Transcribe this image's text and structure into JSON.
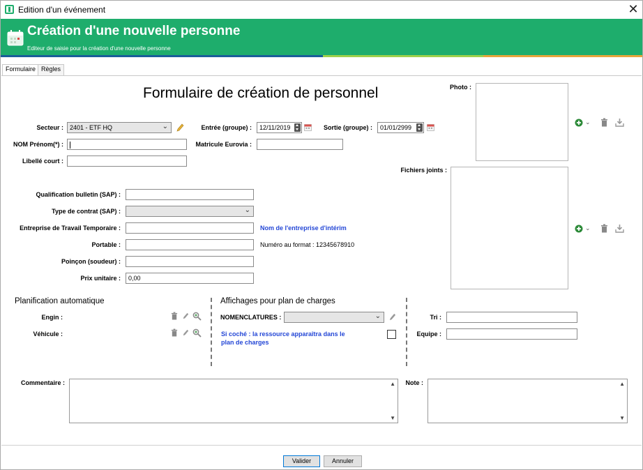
{
  "window": {
    "title": "Edition d'un événement"
  },
  "banner": {
    "title": "Création d'une nouvelle personne",
    "subtitle": "Editeur de saisie pour la création d'une nouvelle personne"
  },
  "tabs": [
    {
      "label": "Formulaire"
    },
    {
      "label": "Règles"
    }
  ],
  "form": {
    "title": "Formulaire de création de personnel",
    "secteur": {
      "label": "Secteur :",
      "value": "2401 - ETF HQ"
    },
    "entree": {
      "label": "Entrée (groupe) :",
      "value": "12/11/2019"
    },
    "sortie": {
      "label": "Sortie (groupe) :",
      "value": "01/01/2999"
    },
    "nom": {
      "label": "NOM Prénom(*) :",
      "value": ""
    },
    "matricule": {
      "label": "Matricule Eurovia :",
      "value": ""
    },
    "libelle": {
      "label": "Libellé court :",
      "value": ""
    },
    "qualification": {
      "label": "Qualification bulletin (SAP) :",
      "value": ""
    },
    "contrat": {
      "label": "Type de contrat (SAP) :",
      "value": ""
    },
    "ett": {
      "label": "Entreprise de Travail Temporaire :",
      "value": "",
      "hint": "Nom de l'entreprise d'intérim"
    },
    "portable": {
      "label": "Portable :",
      "value": "",
      "hint": "Numéro au format : 12345678910"
    },
    "poincon": {
      "label": "Poinçon (soudeur) :",
      "value": ""
    },
    "prix": {
      "label": "Prix unitaire :",
      "value": "0,00"
    }
  },
  "photo": {
    "label": "Photo :"
  },
  "fichiers": {
    "label": "Fichiers joints :"
  },
  "planification": {
    "title": "Planification automatique",
    "engin_label": "Engin :",
    "vehicule_label": "Véhicule :"
  },
  "affichages": {
    "title": "Affichages pour plan de charges",
    "nomenclatures_label": "NOMENCLATURES :",
    "nomenclatures_value": "",
    "note_line1": "Si coché : la ressource apparaîtra dans le",
    "note_line2": "plan de charges",
    "checked": false
  },
  "tri": {
    "label": "Tri :",
    "value": ""
  },
  "equipe": {
    "label": "Equipe :",
    "value": ""
  },
  "commentaire": {
    "label": "Commentaire :",
    "value": ""
  },
  "note": {
    "label": "Note :",
    "value": ""
  },
  "buttons": {
    "valider": "Valider",
    "annuler": "Annuler"
  },
  "colors": {
    "accent": "#1ead6c",
    "link": "#2447d6"
  }
}
